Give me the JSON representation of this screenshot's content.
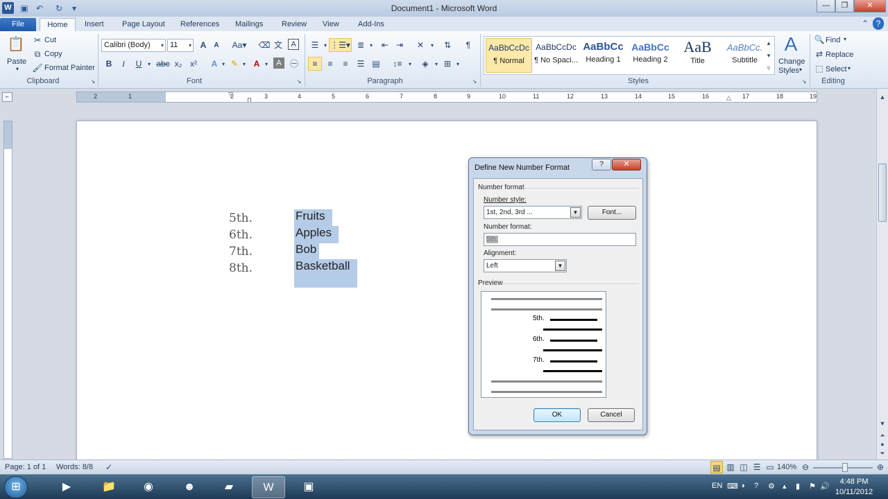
{
  "window": {
    "title": "Document1 - Microsoft Word",
    "minimize": "—",
    "maximize": "❐",
    "close": "✕",
    "help": "?"
  },
  "tabs": [
    "File",
    "Home",
    "Insert",
    "Page Layout",
    "References",
    "Mailings",
    "Review",
    "View",
    "Add-Ins"
  ],
  "ribbon": {
    "clipboard": {
      "label": "Clipboard",
      "paste": "Paste",
      "cut": "Cut",
      "copy": "Copy",
      "format_painter": "Format Painter"
    },
    "font": {
      "label": "Font",
      "font_name": "Calibri (Body)",
      "font_size": "11"
    },
    "paragraph": {
      "label": "Paragraph"
    },
    "styles": {
      "label": "Styles",
      "items": [
        {
          "sample": "AaBbCcDc",
          "name": "¶ Normal"
        },
        {
          "sample": "AaBbCcDc",
          "name": "¶ No Spaci..."
        },
        {
          "sample": "AaBbCc",
          "name": "Heading 1"
        },
        {
          "sample": "AaBbCc",
          "name": "Heading 2"
        },
        {
          "sample": "AaB",
          "name": "Title"
        },
        {
          "sample": "AaBbCc.",
          "name": "Subtitle"
        }
      ],
      "change_styles_1": "Change",
      "change_styles_2": "Styles"
    },
    "editing": {
      "label": "Editing",
      "find": "Find",
      "replace": "Replace",
      "select": "Select"
    }
  },
  "document": {
    "list": [
      {
        "num": "5th.",
        "text": "Fruits"
      },
      {
        "num": "6th.",
        "text": "Apples"
      },
      {
        "num": "7th.",
        "text": "Bob"
      },
      {
        "num": "8th.",
        "text": "Basketball"
      }
    ]
  },
  "dialog": {
    "title": "Define New Number Format",
    "help": "?",
    "close": "✕",
    "section_number_format": "Number format",
    "number_style_label": "Number style:",
    "number_style_value": "1st, 2nd, 3rd ...",
    "font_button": "Font...",
    "number_format_label": "Number format:",
    "number_format_value": "5th.",
    "alignment_label": "Alignment:",
    "alignment_value": "Left",
    "preview_label": "Preview",
    "preview_items": [
      "5th.",
      "6th.",
      "7th."
    ],
    "ok": "OK",
    "cancel": "Cancel"
  },
  "statusbar": {
    "page": "Page: 1 of 1",
    "words": "Words: 8/8",
    "zoom": "140%"
  },
  "taskbar": {
    "lang": "EN",
    "time": "4:48 PM",
    "date": "10/11/2012"
  }
}
